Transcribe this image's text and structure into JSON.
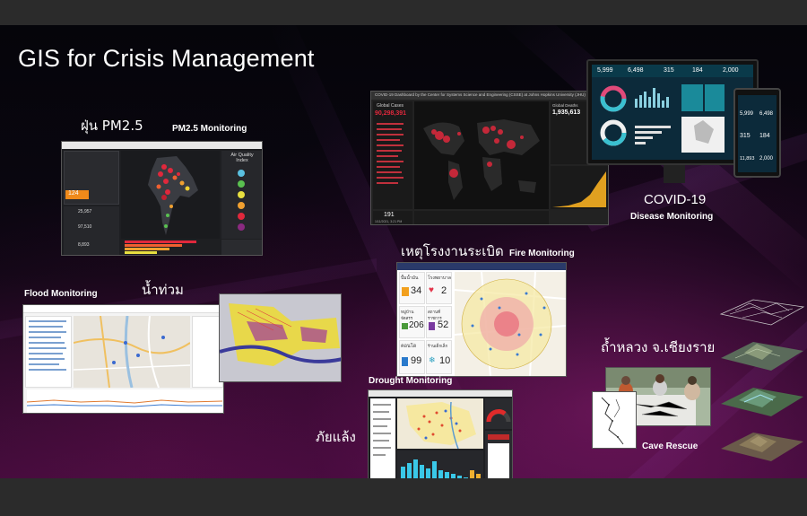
{
  "slide": {
    "title": "GIS for Crisis Management",
    "colors": {
      "background_top": "#05050a",
      "background_bottom": "#3a0a36",
      "accent_magenta": "#b0207a"
    }
  },
  "sections": {
    "pm25": {
      "th_label": "ฝุ่น PM2.5",
      "en_label": "PM2.5 Monitoring"
    },
    "flood": {
      "th_label": "น้ำท่วม",
      "en_label": "Flood Monitoring"
    },
    "covid": {
      "en_label": "COVID-19",
      "en_sublabel": "Disease Monitoring"
    },
    "fire": {
      "th_label": "เหตุโรงงานระเบิด",
      "en_label": "Fire Monitoring"
    },
    "drought": {
      "th_label": "ภัยแล้ง",
      "en_label": "Drought Monitoring"
    },
    "cave": {
      "th_label": "ถ้ำหลวง จ.เชียงราย",
      "en_label": "Cave Rescue"
    }
  },
  "pm25_dashboard": {
    "legend_title": "Air Quality Index",
    "counts": [
      "25,957",
      "97,510",
      "8,893"
    ],
    "highlight_value": "124"
  },
  "covid_dashboard": {
    "header": "COVID-19 Dashboard by the Center for Systems Science and Engineering (CSSE) at Johns Hopkins University (JHU)",
    "global_cases_label": "Global Cases",
    "global_cases": "90,298,391",
    "global_deaths_label": "Global Deaths",
    "global_deaths": "1,935,613",
    "country_count": "191",
    "last_updated": "1/11/2021, 3:21 PM",
    "monitor_stats": [
      "5,999",
      "6,498",
      "315",
      "184",
      "2,000"
    ],
    "tablet_stats": [
      "5,999",
      "6,498",
      "315",
      "184",
      "11,893",
      "2,000"
    ]
  },
  "fire_dashboard": {
    "tiles": [
      {
        "label": "ปั้มน้ำมัน",
        "value": "34"
      },
      {
        "label": "โรงพยาบาล",
        "value": "2"
      },
      {
        "label": "หมู่บ้านจัดสรร",
        "value": "206"
      },
      {
        "label": "สถานที่ราชการ",
        "value": "52"
      },
      {
        "label": "คอนโด",
        "value": "99"
      },
      {
        "label": "ร้านเด็กเล็ก",
        "value": "10"
      }
    ],
    "tile_colors": [
      "#f2a01e",
      "#e2344a",
      "#4a9a3a",
      "#7a3aa0",
      "#2a7acc",
      "#2aa0c0"
    ]
  }
}
